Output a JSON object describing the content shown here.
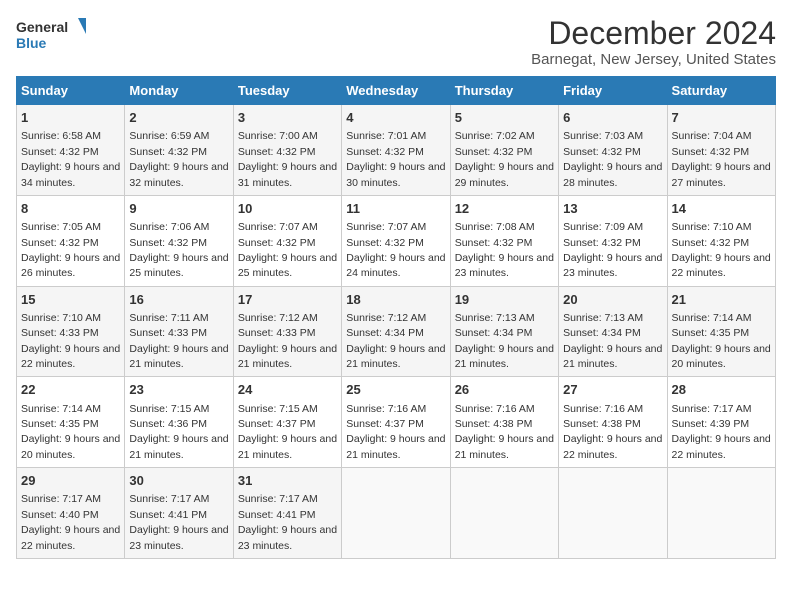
{
  "logo": {
    "line1": "General",
    "line2": "Blue"
  },
  "title": "December 2024",
  "subtitle": "Barnegat, New Jersey, United States",
  "days_header": [
    "Sunday",
    "Monday",
    "Tuesday",
    "Wednesday",
    "Thursday",
    "Friday",
    "Saturday"
  ],
  "weeks": [
    [
      {
        "day": "1",
        "sunrise": "6:58 AM",
        "sunset": "4:32 PM",
        "daylight": "9 hours and 34 minutes."
      },
      {
        "day": "2",
        "sunrise": "6:59 AM",
        "sunset": "4:32 PM",
        "daylight": "9 hours and 32 minutes."
      },
      {
        "day": "3",
        "sunrise": "7:00 AM",
        "sunset": "4:32 PM",
        "daylight": "9 hours and 31 minutes."
      },
      {
        "day": "4",
        "sunrise": "7:01 AM",
        "sunset": "4:32 PM",
        "daylight": "9 hours and 30 minutes."
      },
      {
        "day": "5",
        "sunrise": "7:02 AM",
        "sunset": "4:32 PM",
        "daylight": "9 hours and 29 minutes."
      },
      {
        "day": "6",
        "sunrise": "7:03 AM",
        "sunset": "4:32 PM",
        "daylight": "9 hours and 28 minutes."
      },
      {
        "day": "7",
        "sunrise": "7:04 AM",
        "sunset": "4:32 PM",
        "daylight": "9 hours and 27 minutes."
      }
    ],
    [
      {
        "day": "8",
        "sunrise": "7:05 AM",
        "sunset": "4:32 PM",
        "daylight": "9 hours and 26 minutes."
      },
      {
        "day": "9",
        "sunrise": "7:06 AM",
        "sunset": "4:32 PM",
        "daylight": "9 hours and 25 minutes."
      },
      {
        "day": "10",
        "sunrise": "7:07 AM",
        "sunset": "4:32 PM",
        "daylight": "9 hours and 25 minutes."
      },
      {
        "day": "11",
        "sunrise": "7:07 AM",
        "sunset": "4:32 PM",
        "daylight": "9 hours and 24 minutes."
      },
      {
        "day": "12",
        "sunrise": "7:08 AM",
        "sunset": "4:32 PM",
        "daylight": "9 hours and 23 minutes."
      },
      {
        "day": "13",
        "sunrise": "7:09 AM",
        "sunset": "4:32 PM",
        "daylight": "9 hours and 23 minutes."
      },
      {
        "day": "14",
        "sunrise": "7:10 AM",
        "sunset": "4:32 PM",
        "daylight": "9 hours and 22 minutes."
      }
    ],
    [
      {
        "day": "15",
        "sunrise": "7:10 AM",
        "sunset": "4:33 PM",
        "daylight": "9 hours and 22 minutes."
      },
      {
        "day": "16",
        "sunrise": "7:11 AM",
        "sunset": "4:33 PM",
        "daylight": "9 hours and 21 minutes."
      },
      {
        "day": "17",
        "sunrise": "7:12 AM",
        "sunset": "4:33 PM",
        "daylight": "9 hours and 21 minutes."
      },
      {
        "day": "18",
        "sunrise": "7:12 AM",
        "sunset": "4:34 PM",
        "daylight": "9 hours and 21 minutes."
      },
      {
        "day": "19",
        "sunrise": "7:13 AM",
        "sunset": "4:34 PM",
        "daylight": "9 hours and 21 minutes."
      },
      {
        "day": "20",
        "sunrise": "7:13 AM",
        "sunset": "4:34 PM",
        "daylight": "9 hours and 21 minutes."
      },
      {
        "day": "21",
        "sunrise": "7:14 AM",
        "sunset": "4:35 PM",
        "daylight": "9 hours and 20 minutes."
      }
    ],
    [
      {
        "day": "22",
        "sunrise": "7:14 AM",
        "sunset": "4:35 PM",
        "daylight": "9 hours and 20 minutes."
      },
      {
        "day": "23",
        "sunrise": "7:15 AM",
        "sunset": "4:36 PM",
        "daylight": "9 hours and 21 minutes."
      },
      {
        "day": "24",
        "sunrise": "7:15 AM",
        "sunset": "4:37 PM",
        "daylight": "9 hours and 21 minutes."
      },
      {
        "day": "25",
        "sunrise": "7:16 AM",
        "sunset": "4:37 PM",
        "daylight": "9 hours and 21 minutes."
      },
      {
        "day": "26",
        "sunrise": "7:16 AM",
        "sunset": "4:38 PM",
        "daylight": "9 hours and 21 minutes."
      },
      {
        "day": "27",
        "sunrise": "7:16 AM",
        "sunset": "4:38 PM",
        "daylight": "9 hours and 22 minutes."
      },
      {
        "day": "28",
        "sunrise": "7:17 AM",
        "sunset": "4:39 PM",
        "daylight": "9 hours and 22 minutes."
      }
    ],
    [
      {
        "day": "29",
        "sunrise": "7:17 AM",
        "sunset": "4:40 PM",
        "daylight": "9 hours and 22 minutes."
      },
      {
        "day": "30",
        "sunrise": "7:17 AM",
        "sunset": "4:41 PM",
        "daylight": "9 hours and 23 minutes."
      },
      {
        "day": "31",
        "sunrise": "7:17 AM",
        "sunset": "4:41 PM",
        "daylight": "9 hours and 23 minutes."
      },
      null,
      null,
      null,
      null
    ]
  ],
  "labels": {
    "sunrise": "Sunrise:",
    "sunset": "Sunset:",
    "daylight": "Daylight:"
  }
}
